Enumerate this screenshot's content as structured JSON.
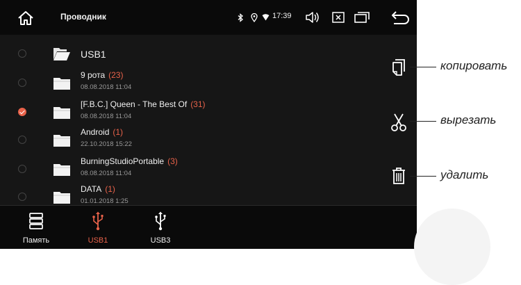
{
  "header": {
    "title": "Проводник",
    "clock": "17:39",
    "icons": [
      "home-icon",
      "bluetooth-icon",
      "location-icon",
      "wifi-icon",
      "volume-icon",
      "close-window-icon",
      "window-icon",
      "back-icon"
    ]
  },
  "files": [
    {
      "name": "USB1",
      "count": "",
      "date": "",
      "selected": false
    },
    {
      "name": "9 рота",
      "count": "(23)",
      "date": "08.08.2018 11:04",
      "selected": false
    },
    {
      "name": "[F.B.C.] Queen - The Best Of",
      "count": "(31)",
      "date": "08.08.2018 11:04",
      "selected": true
    },
    {
      "name": "Android",
      "count": "(1)",
      "date": "22.10.2018 15:22",
      "selected": false
    },
    {
      "name": "BurningStudioPortable",
      "count": "(3)",
      "date": "08.08.2018 11:04",
      "selected": false
    },
    {
      "name": "DATA",
      "count": "(1)",
      "date": "01.01.2018 1:25",
      "selected": false
    }
  ],
  "side_actions": [
    {
      "icon": "copy-icon",
      "annotation": "копировать"
    },
    {
      "icon": "scissors-icon",
      "annotation": "вырезать"
    },
    {
      "icon": "trash-icon",
      "annotation": "удалить"
    }
  ],
  "tabs": [
    {
      "label": "Память",
      "icon": "storage-icon",
      "active": false
    },
    {
      "label": "USB1",
      "icon": "usb-icon",
      "active": true
    },
    {
      "label": "USB3",
      "icon": "usb-icon",
      "active": false
    }
  ],
  "colors": {
    "accent": "#e8624a",
    "background": "#161616",
    "bar": "#0a0a0a"
  }
}
